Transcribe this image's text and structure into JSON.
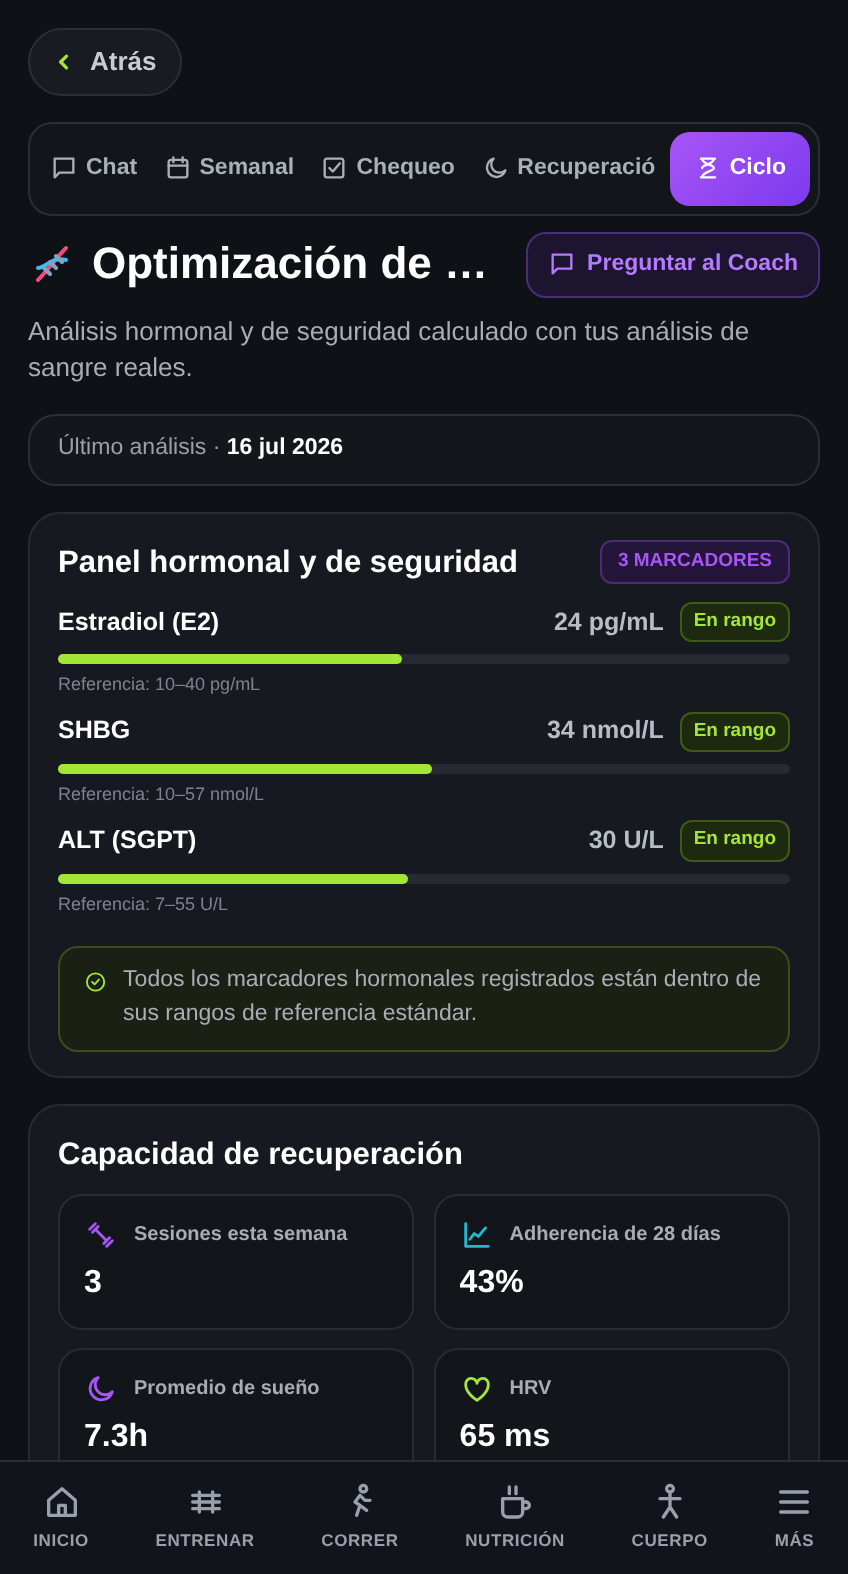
{
  "back": {
    "label": "Atrás"
  },
  "tabs": [
    {
      "label": "Chat",
      "selected": false
    },
    {
      "label": "Semanal",
      "selected": false
    },
    {
      "label": "Chequeo",
      "selected": false
    },
    {
      "label": "Recuperació",
      "selected": false
    },
    {
      "label": "Ciclo",
      "selected": true
    }
  ],
  "header": {
    "title": "Optimización de …",
    "coach_button": "Preguntar al Coach",
    "description": "Análisis hormonal y de seguridad calculado con tus análisis de sangre reales."
  },
  "last_analysis": {
    "label": "Último análisis · ",
    "date": "16 jul 2026"
  },
  "hormone_panel": {
    "title": "Panel hormonal y de seguridad",
    "badge": "3 MARCADORES",
    "markers": [
      {
        "name": "Estradiol (E2)",
        "value": "24 pg/mL",
        "status": "En rango",
        "level": 0.47,
        "reference": "Referencia: 10–40 pg/mL"
      },
      {
        "name": "SHBG",
        "value": "34 nmol/L",
        "status": "En rango",
        "level": 0.51,
        "reference": "Referencia: 10–57 nmol/L"
      },
      {
        "name": "ALT (SGPT)",
        "value": "30 U/L",
        "status": "En rango",
        "level": 0.478,
        "reference": "Referencia: 7–55 U/L"
      }
    ],
    "note": "Todos los marcadores hormonales registrados están dentro de sus rangos de referencia estándar."
  },
  "recovery": {
    "title": "Capacidad de recuperación",
    "stats": [
      {
        "label": "Sesiones esta semana",
        "value": "3",
        "color": "#a855f7"
      },
      {
        "label": "Adherencia de 28 días",
        "value": "43%",
        "color": "#22b8cf"
      },
      {
        "label": "Promedio de sueño",
        "value": "7.3h",
        "color": "#a855f7"
      },
      {
        "label": "HRV",
        "value": "65 ms",
        "color": "#a3e635"
      }
    ]
  },
  "bottom_nav": [
    {
      "label": "INICIO",
      "selected": false
    },
    {
      "label": "ENTRENAR",
      "selected": false
    },
    {
      "label": "CORRER",
      "selected": false
    },
    {
      "label": "NUTRICIÓN",
      "selected": false
    },
    {
      "label": "CUERPO",
      "selected": false
    },
    {
      "label": "MÁS",
      "selected": false
    }
  ]
}
